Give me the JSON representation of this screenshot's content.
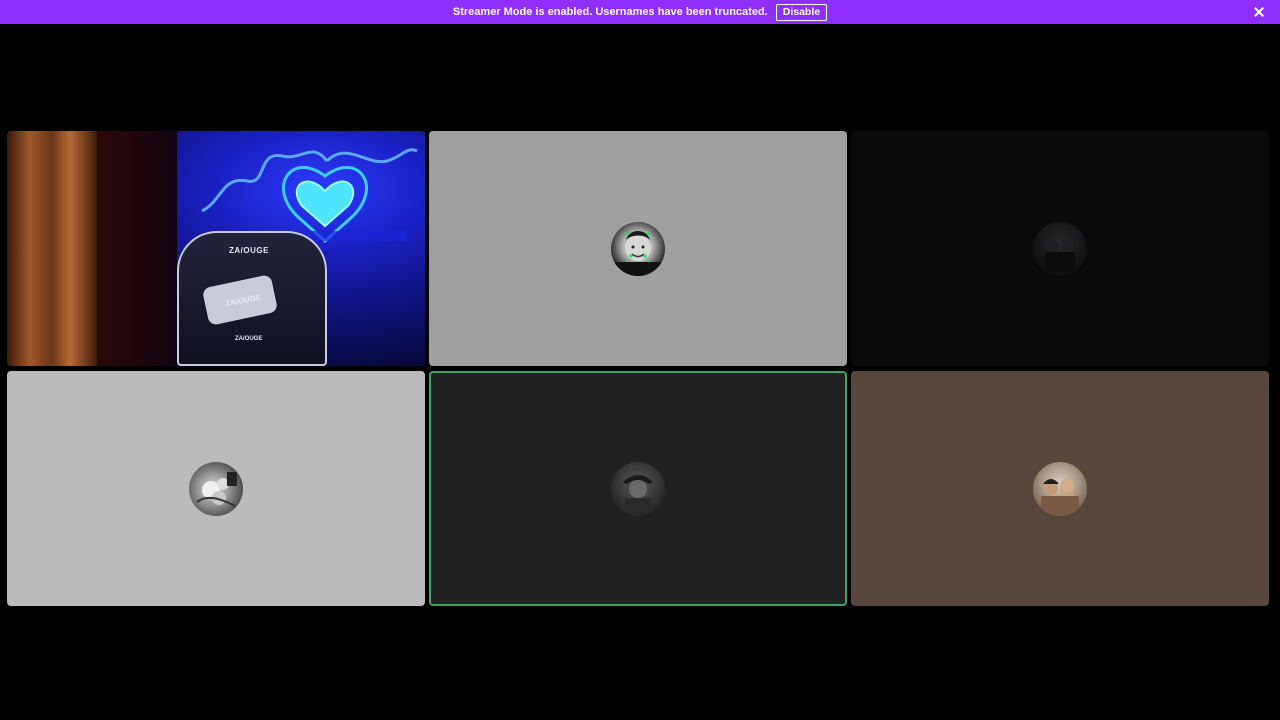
{
  "banner": {
    "message": "Streamer Mode is enabled. Usernames have been truncated.",
    "button_label": "Disable",
    "color": "#8f2fff"
  },
  "tiles": [
    {
      "type": "stream",
      "bg": "#0c0f6a",
      "chair_brand": "ZA/OUGE"
    },
    {
      "type": "avatar",
      "bg": "#9f9f9f",
      "avatar": "person-smiling-avatar",
      "speaking": false
    },
    {
      "type": "avatar",
      "bg": "#0a0a0b",
      "avatar": "dark-photo-avatar",
      "speaking": false
    },
    {
      "type": "avatar",
      "bg": "#bbbbbb",
      "avatar": "flowers-avatar",
      "speaking": false
    },
    {
      "type": "avatar",
      "bg": "#222222",
      "avatar": "person-hat-avatar",
      "speaking": true
    },
    {
      "type": "avatar",
      "bg": "#56463b",
      "avatar": "couple-avatar",
      "speaking": false
    }
  ],
  "speaking_color": "#3ba55d"
}
